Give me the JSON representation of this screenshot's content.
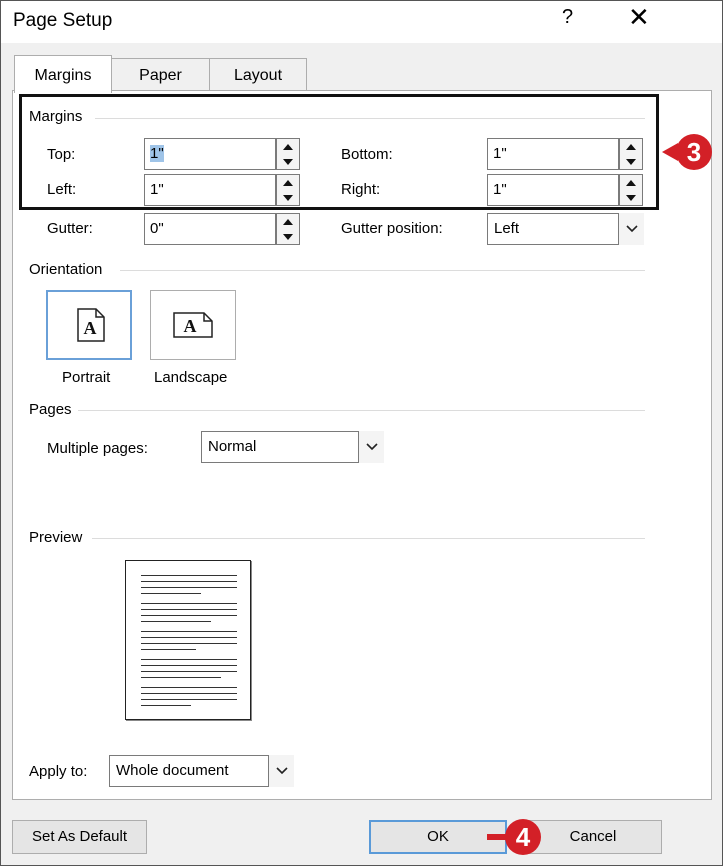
{
  "dialog": {
    "title": "Page Setup",
    "help_label": "?",
    "close_label": "✕"
  },
  "tabs": [
    {
      "label": "Margins",
      "active": true
    },
    {
      "label": "Paper",
      "active": false
    },
    {
      "label": "Layout",
      "active": false
    }
  ],
  "margins": {
    "section_label": "Margins",
    "top": {
      "label": "Top:",
      "value": "1\""
    },
    "bottom": {
      "label": "Bottom:",
      "value": "1\""
    },
    "left": {
      "label": "Left:",
      "value": "1\""
    },
    "right": {
      "label": "Right:",
      "value": "1\""
    },
    "gutter": {
      "label": "Gutter:",
      "value": "0\""
    },
    "gutter_position": {
      "label": "Gutter position:",
      "value": "Left"
    }
  },
  "orientation": {
    "section_label": "Orientation",
    "portrait_label": "Portrait",
    "landscape_label": "Landscape",
    "page_glyph": "A",
    "selected": "portrait"
  },
  "pages": {
    "section_label": "Pages",
    "multiple_pages_label": "Multiple pages:",
    "multiple_pages_value": "Normal"
  },
  "preview": {
    "section_label": "Preview"
  },
  "apply_to": {
    "label": "Apply to:",
    "value": "Whole document"
  },
  "buttons": {
    "set_as_default": "Set As Default",
    "ok": "OK",
    "cancel": "Cancel"
  },
  "callouts": {
    "margins_step": "3",
    "ok_step": "4",
    "color": "#d32027"
  },
  "icons": [
    "help-icon",
    "close-icon",
    "spin-up-icon",
    "spin-down-icon",
    "chevron-down-icon",
    "portrait-page-icon",
    "landscape-page-icon"
  ]
}
